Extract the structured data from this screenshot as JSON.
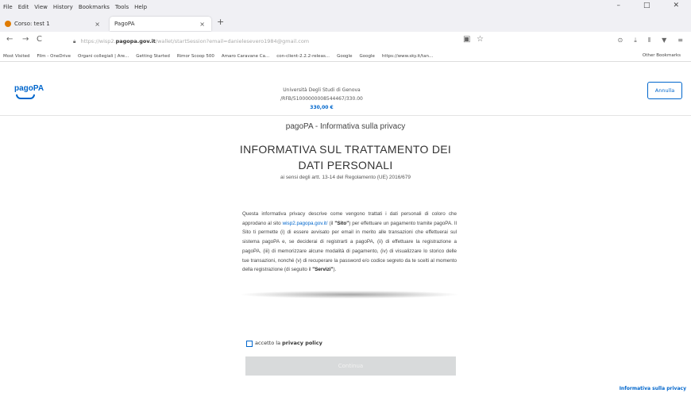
{
  "menubar": {
    "items": [
      "File",
      "Edit",
      "View",
      "History",
      "Bookmarks",
      "Tools",
      "Help"
    ]
  },
  "window": {
    "minimize": "–",
    "maximize": "□",
    "close": "✕"
  },
  "tabs": [
    {
      "label": "Corso: test 1",
      "close": "×"
    },
    {
      "label": "PagoPA",
      "close": "×"
    }
  ],
  "newtab": "+",
  "nav": {
    "back": "←",
    "forward": "→",
    "reload": "C",
    "url_prefix": "https://wisp2.",
    "url_domain": "pagopa.gov.it",
    "url_rest": "/wallet/startSession?email=danielesevero1984@gmail.com",
    "right_icons": [
      "▣",
      "☆",
      "⊙",
      "⤓",
      "⫴",
      "▼",
      "≡"
    ]
  },
  "bookmarks": {
    "items": [
      "Most Visited",
      "Film - OneDrive",
      "Organi collegiali | Are...",
      "Getting Started",
      "Rimor Scoop 500",
      "Amaro Caravane Ca...",
      "con-client-2.2.2-releas...",
      "Google",
      "Google",
      "https://www.sky.it/tan..."
    ],
    "right": "Other Bookmarks"
  },
  "header": {
    "logo": "pagoPA",
    "institution": "Università Degli Studi di Genova",
    "reference": "/RFB/51000000008544467/330.00",
    "amount": "330,00 €",
    "cancel": "Annulla"
  },
  "page": {
    "subtitle": "pagoPA - Informativa sulla privacy",
    "title": "INFORMATIVA SUL TRATTAMENTO DEI DATI PERSONALI",
    "regulation": "ai sensi degli artt. 13-14 del Regolamento (UE) 2016/679",
    "body_part1": "Questa informativa privacy descrive come vengono trattati i dati personali di coloro che approdano al sito ",
    "body_link": "wisp2.pagopa.gov.it/",
    "body_part2": " (il ",
    "body_sito": "\"Sito\"",
    "body_part3": ") per effettuare un pagamento tramite pagoPA. Il Sito ti permette (i) di essere avvisato per email in merito alle transazioni che effettuerai sul sistema pagoPA e, se deciderai di registrarti a pagoPA, (ii) di effettuare la registrazione a pagoPA, (iii) di memorizzare alcune modalità di pagamento, (iv) di visualizzare lo storico delle tue transazioni, nonché (v) di recuperare la password e/o codice segreto da te scelti al momento della registrazione (di seguito il ",
    "body_servizi": "\"Servizi\"",
    "body_part4": ").",
    "consent_prefix": "accetto la ",
    "consent_bold": "privacy policy",
    "continue": "Continua",
    "footer_link": "Informativa sulla privacy"
  },
  "colors": {
    "accent": "#0066cc",
    "button_disabled": "#d8dadb"
  }
}
